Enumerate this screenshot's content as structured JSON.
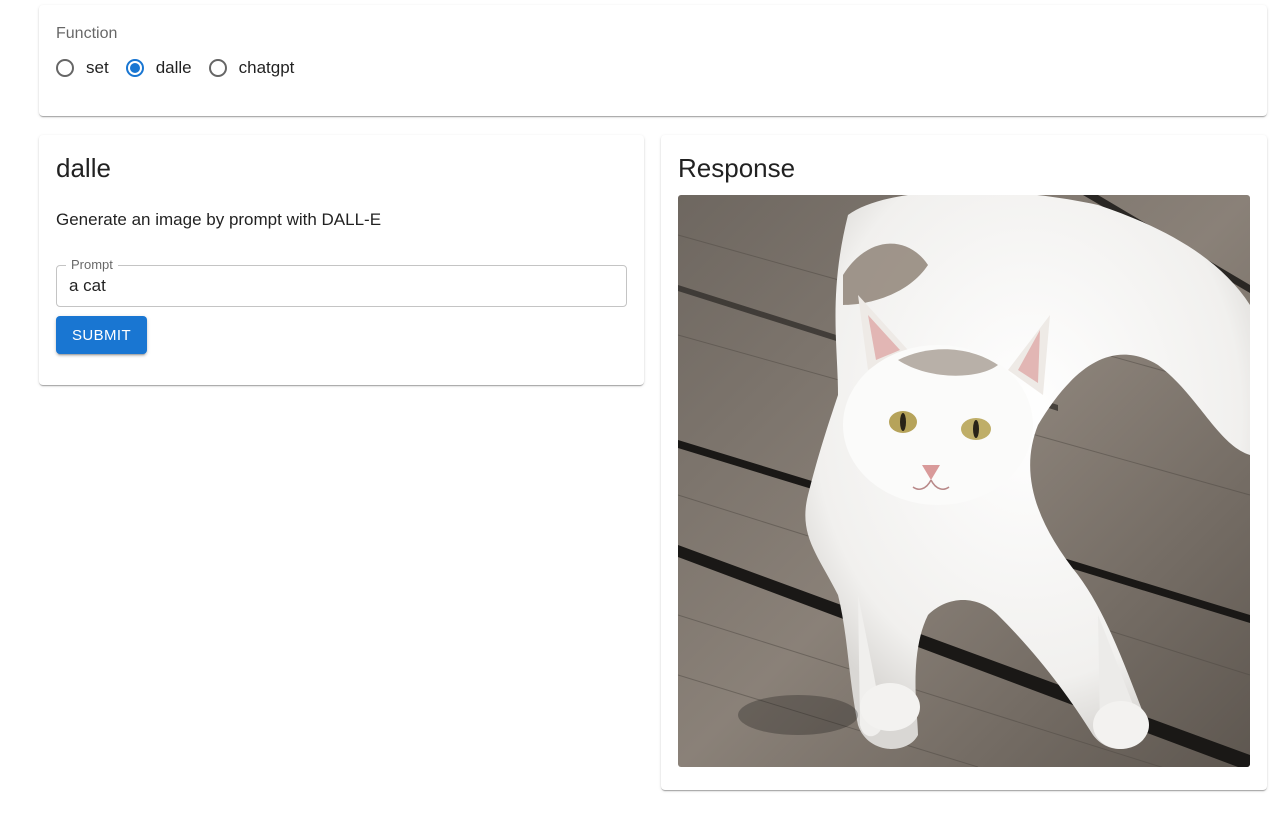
{
  "function_selector": {
    "legend": "Function",
    "options": [
      {
        "label": "set",
        "checked": false
      },
      {
        "label": "dalle",
        "checked": true
      },
      {
        "label": "chatgpt",
        "checked": false
      }
    ]
  },
  "form": {
    "title": "dalle",
    "description": "Generate an image by prompt with DALL-E",
    "prompt": {
      "label": "Prompt",
      "value": "a cat"
    },
    "submit_label": "SUBMIT"
  },
  "response": {
    "title": "Response",
    "image_subject": "white cat lying on wooden planks"
  },
  "colors": {
    "primary": "#1976d2",
    "background": "#ffffff"
  }
}
